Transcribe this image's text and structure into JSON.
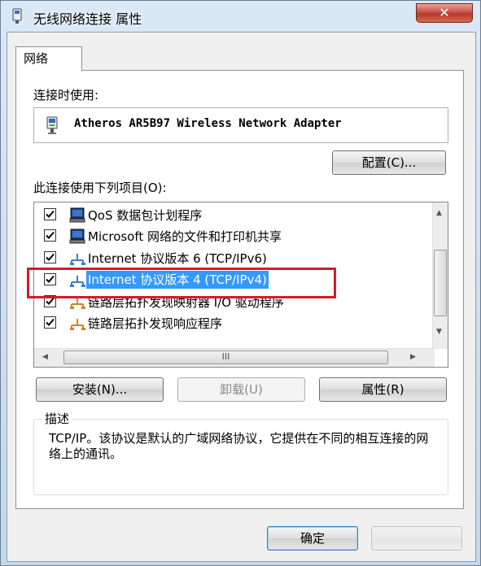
{
  "window": {
    "title": "无线网络连接 属性",
    "close_glyph": "✕"
  },
  "tab": {
    "label": "网络"
  },
  "connect_using": {
    "label": "连接时使用:",
    "adapter": "Atheros AR5B97 Wireless Network Adapter",
    "configure_button": "配置(C)..."
  },
  "items_section": {
    "label": "此连接使用下列项目(O):",
    "items": [
      {
        "label": "QoS 数据包计划程序",
        "checked": true,
        "icon": "network-client-icon"
      },
      {
        "label": "Microsoft 网络的文件和打印机共享",
        "checked": true,
        "icon": "network-client-icon"
      },
      {
        "label": "Internet 协议版本 6 (TCP/IPv6)",
        "checked": true,
        "icon": "protocol-icon"
      },
      {
        "label": "Internet 协议版本 4 (TCP/IPv4)",
        "checked": true,
        "icon": "protocol-icon",
        "selected": true
      },
      {
        "label": "链路层拓扑发现映射器 I/O 驱动程序",
        "checked": true,
        "icon": "protocol-icon"
      },
      {
        "label": "链路层拓扑发现响应程序",
        "checked": true,
        "icon": "protocol-icon"
      }
    ],
    "hscroll_grip": "III"
  },
  "buttons": {
    "install": "安装(N)...",
    "uninstall": "卸载(U)",
    "properties": "属性(R)"
  },
  "description": {
    "title": "描述",
    "text": "TCP/IP。该协议是默认的广域网络协议，它提供在不同的相互连接的网络上的通讯。"
  },
  "footer": {
    "ok_button": "确定"
  },
  "colors": {
    "selection": "#3399ff",
    "highlight_annotation": "#d8192b",
    "close_button": "#c75050"
  }
}
